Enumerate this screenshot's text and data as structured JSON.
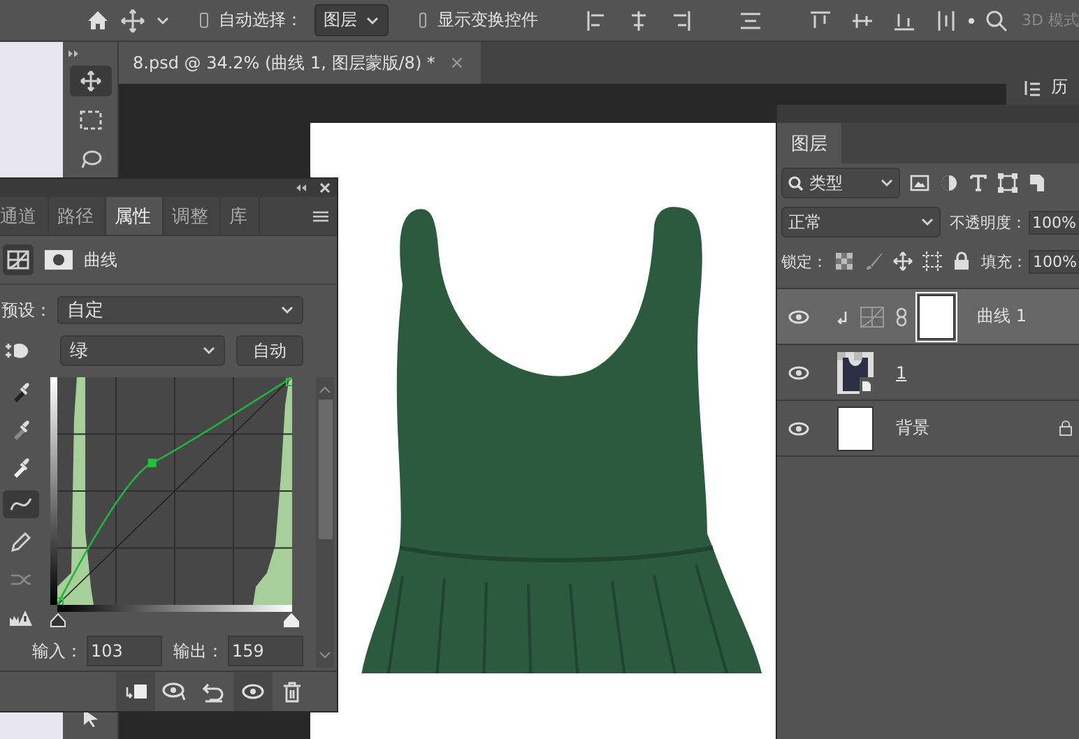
{
  "options_bar": {
    "auto_select_checked": false,
    "auto_select_label": "自动选择：",
    "target_dropdown": "图层",
    "transform_checked": false,
    "transform_label": "显示变换控件",
    "mode_3d": "3D 模式"
  },
  "document_tab": {
    "title": "8.psd @ 34.2% (曲线 1, 图层蒙版/8) *",
    "close": "×"
  },
  "side_panel": {
    "label": "历"
  },
  "properties_panel": {
    "tabs": [
      {
        "label": "通道",
        "selected": false
      },
      {
        "label": "路径",
        "selected": false
      },
      {
        "label": "属性",
        "selected": true
      },
      {
        "label": "调整",
        "selected": false
      },
      {
        "label": "库",
        "selected": false
      }
    ],
    "heading": "曲线",
    "preset_label": "预设：",
    "preset": "自定",
    "channel": "绿",
    "auto_button": "自动",
    "shadows_slider": {
      "level": 0
    },
    "highlights_slider": {
      "level": 1
    },
    "input_label": "输入：",
    "input": "103",
    "output_label": "输出：",
    "output": "159"
  },
  "layers_panel": {
    "tab": "图层",
    "filter": "类型",
    "blend_mode": "正常",
    "opacity_label": "不透明度：",
    "opacity": "100%",
    "lock_label": "锁定：",
    "fill_label": "填充：",
    "fill": "100%",
    "layers": [
      {
        "name": "曲线 1",
        "kind": "adjustment",
        "selected": true,
        "visible": true,
        "locked": false
      },
      {
        "name": "1",
        "kind": "smart",
        "selected": false,
        "visible": true,
        "locked": false
      },
      {
        "name": "背景",
        "kind": "background",
        "selected": false,
        "visible": true,
        "locked": true
      }
    ]
  }
}
